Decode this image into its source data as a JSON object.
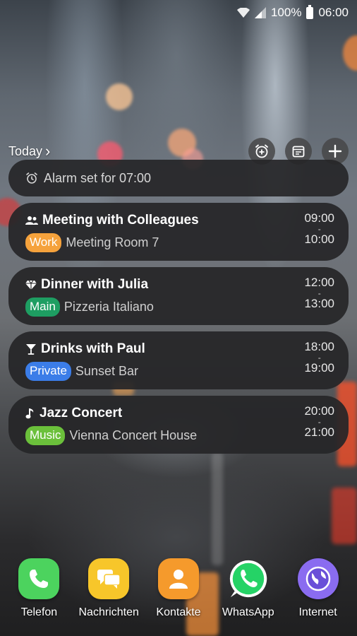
{
  "status_bar": {
    "battery_percent": "100%",
    "time": "06:00",
    "icons": [
      "wifi-icon",
      "signal-icon",
      "battery-icon"
    ]
  },
  "widget": {
    "header_label": "Today",
    "header_chevron": "›",
    "actions": [
      "alarm-add-icon",
      "calendar-icon",
      "plus-icon"
    ],
    "alarm_text": "Alarm set for 07:00",
    "events": [
      {
        "icon": "people-icon",
        "title": "Meeting with Colleagues",
        "tag": "Work",
        "tag_color": "#f5a23c",
        "location": "Meeting Room 7",
        "start": "09:00",
        "end": "10:00",
        "dash": "-"
      },
      {
        "icon": "diamond-icon",
        "title": "Dinner with Julia",
        "tag": "Main",
        "tag_color": "#1e9e62",
        "location": "Pizzeria Italiano",
        "start": "12:00",
        "end": "13:00",
        "dash": "-"
      },
      {
        "icon": "cocktail-icon",
        "title": "Drinks with Paul",
        "tag": "Private",
        "tag_color": "#3b7de8",
        "location": "Sunset Bar",
        "start": "18:00",
        "end": "19:00",
        "dash": "-"
      },
      {
        "icon": "music-note-icon",
        "title": "Jazz Concert",
        "tag": "Music",
        "tag_color": "#6bc03b",
        "location": "Vienna Concert House",
        "start": "20:00",
        "end": "21:00",
        "dash": "-"
      }
    ]
  },
  "dock": {
    "apps": [
      {
        "label": "Telefon",
        "icon": "phone-icon",
        "color": "#4cd35e"
      },
      {
        "label": "Nachrichten",
        "icon": "messages-icon",
        "color": "#f7c62a"
      },
      {
        "label": "Kontakte",
        "icon": "contacts-icon",
        "color": "#f59a2c"
      },
      {
        "label": "WhatsApp",
        "icon": "whatsapp-icon",
        "color": "#25d366"
      },
      {
        "label": "Internet",
        "icon": "internet-icon",
        "color": "#8a6cf0"
      }
    ]
  }
}
